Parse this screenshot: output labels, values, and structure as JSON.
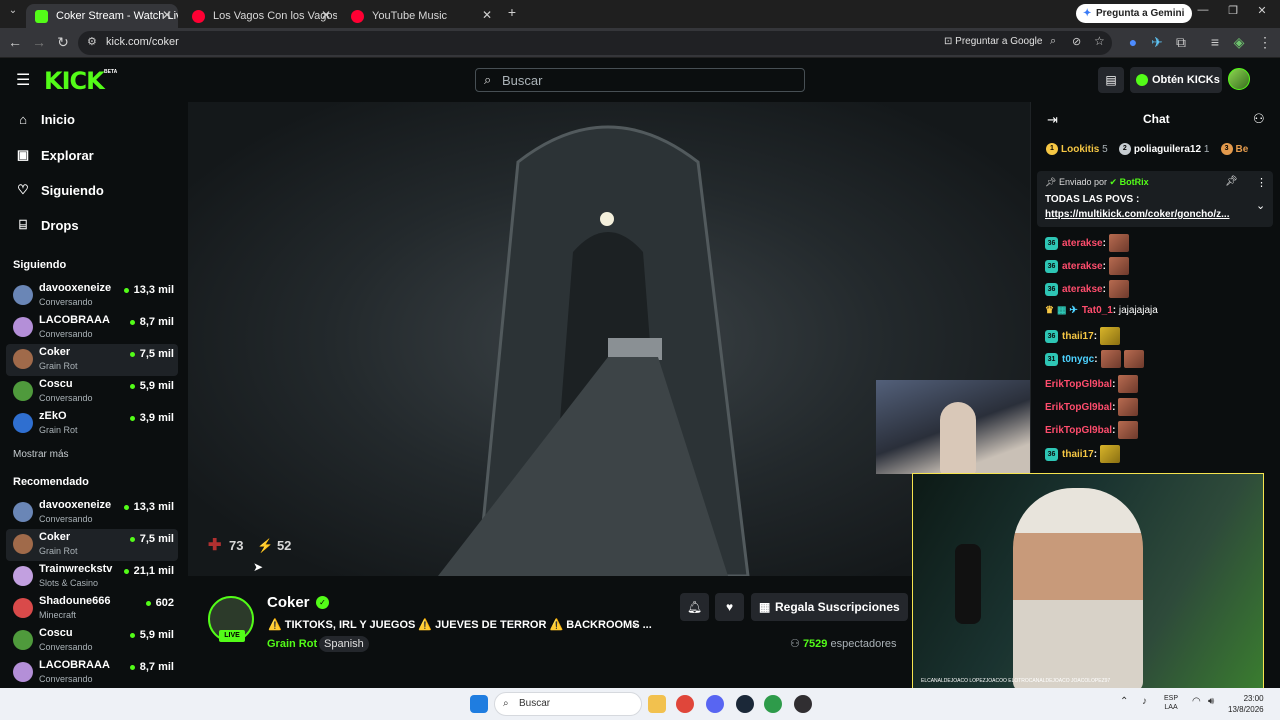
{
  "browser": {
    "tabs": [
      {
        "label": "Coker Stream - Watch Live on K",
        "active": true
      },
      {
        "label": "Los Vagos Con los Vagos (con L",
        "active": false
      },
      {
        "label": "YouTube Music",
        "active": false
      }
    ],
    "url": "kick.com/coker",
    "gemini_label": "Pregunta a Gemini",
    "ask_google_label": "Preguntar a Google"
  },
  "header": {
    "logo": "KICK",
    "logo_badge": "BETA",
    "search_placeholder": "Buscar",
    "kicks_label": "Obtén KICKs"
  },
  "sidebar": {
    "nav": [
      {
        "label": "Inicio",
        "icon": "home-icon"
      },
      {
        "label": "Explorar",
        "icon": "browse-icon"
      },
      {
        "label": "Siguiendo",
        "icon": "heart-icon"
      },
      {
        "label": "Drops",
        "icon": "drops-icon"
      }
    ],
    "following_title": "Siguiendo",
    "following": [
      {
        "name": "davooxeneize",
        "category": "Conversando",
        "viewers": "13,3 mil"
      },
      {
        "name": "LACOBRAAA",
        "category": "Conversando",
        "viewers": "8,7 mil"
      },
      {
        "name": "Coker",
        "category": "Grain Rot",
        "viewers": "7,5 mil"
      },
      {
        "name": "Coscu",
        "category": "Conversando",
        "viewers": "5,9 mil"
      },
      {
        "name": "zEkO",
        "category": "Grain Rot",
        "viewers": "3,9 mil"
      }
    ],
    "show_more": "Mostrar más",
    "recommended_title": "Recomendado",
    "recommended": [
      {
        "name": "davooxeneize",
        "category": "Conversando",
        "viewers": "13,3 mil"
      },
      {
        "name": "Coker",
        "category": "Grain Rot",
        "viewers": "7,5 mil"
      },
      {
        "name": "Trainwreckstv",
        "category": "Slots & Casino",
        "viewers": "21,1 mil"
      },
      {
        "name": "Shadoune666",
        "category": "Minecraft",
        "viewers": "602"
      },
      {
        "name": "Coscu",
        "category": "Conversando",
        "viewers": "5,9 mil"
      },
      {
        "name": "LACOBRAAA",
        "category": "Conversando",
        "viewers": "8,7 mil"
      }
    ]
  },
  "player": {
    "health": "73",
    "energy": "52"
  },
  "stream": {
    "streamer": "Coker",
    "live_label": "LIVE",
    "title": "⚠️ TIKTOKS, IRL Y JUEGOS ⚠️ JUEVES DE TERROR ⚠️ BACKROOMS ...",
    "category": "Grain Rot",
    "language": "Spanish",
    "gift_label": "Regala Suscripciones",
    "viewers_count": "7529",
    "viewers_label": "espectadores"
  },
  "chat": {
    "title": "Chat",
    "leaders": [
      {
        "rank": "1",
        "name": "Lookitis",
        "count": "5",
        "color": "#f6c744"
      },
      {
        "rank": "2",
        "name": "poliaguilera12",
        "count": "1",
        "color": "#c7cdd1"
      },
      {
        "rank": "3",
        "name": "Be",
        "count": "",
        "color": "#e39a4d"
      }
    ],
    "pinned_prefix": "Enviado por",
    "pinned_by": "BotRix",
    "pinned_text": "TODAS LAS POVS :",
    "pinned_link": "https://multikick.com/coker/goncho/z...",
    "messages": [
      {
        "badge": "36",
        "user": "aterakse",
        "color": "#ff4d6d",
        "text": "",
        "emotes": 1
      },
      {
        "badge": "36",
        "user": "aterakse",
        "color": "#ff4d6d",
        "text": "",
        "emotes": 1
      },
      {
        "badge": "36",
        "user": "aterakse",
        "color": "#ff4d6d",
        "text": "",
        "emotes": 1
      },
      {
        "badge": "",
        "user": "Tat0_1",
        "color": "#ff4d6d",
        "text": " jajajajaja",
        "emotes": 0
      },
      {
        "badge": "36",
        "user": "thaii17",
        "color": "#f6c744",
        "text": "",
        "emotes": 1,
        "gold": true
      },
      {
        "badge": "31",
        "user": "t0nygc",
        "color": "#4dd2ff",
        "text": "",
        "emotes": 2
      },
      {
        "badge": "",
        "user": "ErikTopGl9bal",
        "color": "#ff4d6d",
        "text": "",
        "emotes": 1
      },
      {
        "badge": "",
        "user": "ErikTopGl9bal",
        "color": "#ff4d6d",
        "text": "",
        "emotes": 1
      },
      {
        "badge": "",
        "user": "ErikTopGl9bal",
        "color": "#ff4d6d",
        "text": "",
        "emotes": 1
      },
      {
        "badge": "36",
        "user": "thaii17",
        "color": "#f6c744",
        "text": "",
        "emotes": 1,
        "gold": true
      }
    ]
  },
  "webcam": {
    "footer": "ELCANALDEJOACO   LOPEZJOACOO   ELOTROCANALDEJOACO   JOACOLOPEZ97"
  },
  "taskbar": {
    "search_placeholder": "Buscar",
    "lang_line1": "ESP",
    "lang_line2": "LAA",
    "time": "23:00",
    "date": "13/8/2026"
  },
  "colors": {
    "accent": "#53fc18",
    "background": "#0b0e0f"
  }
}
